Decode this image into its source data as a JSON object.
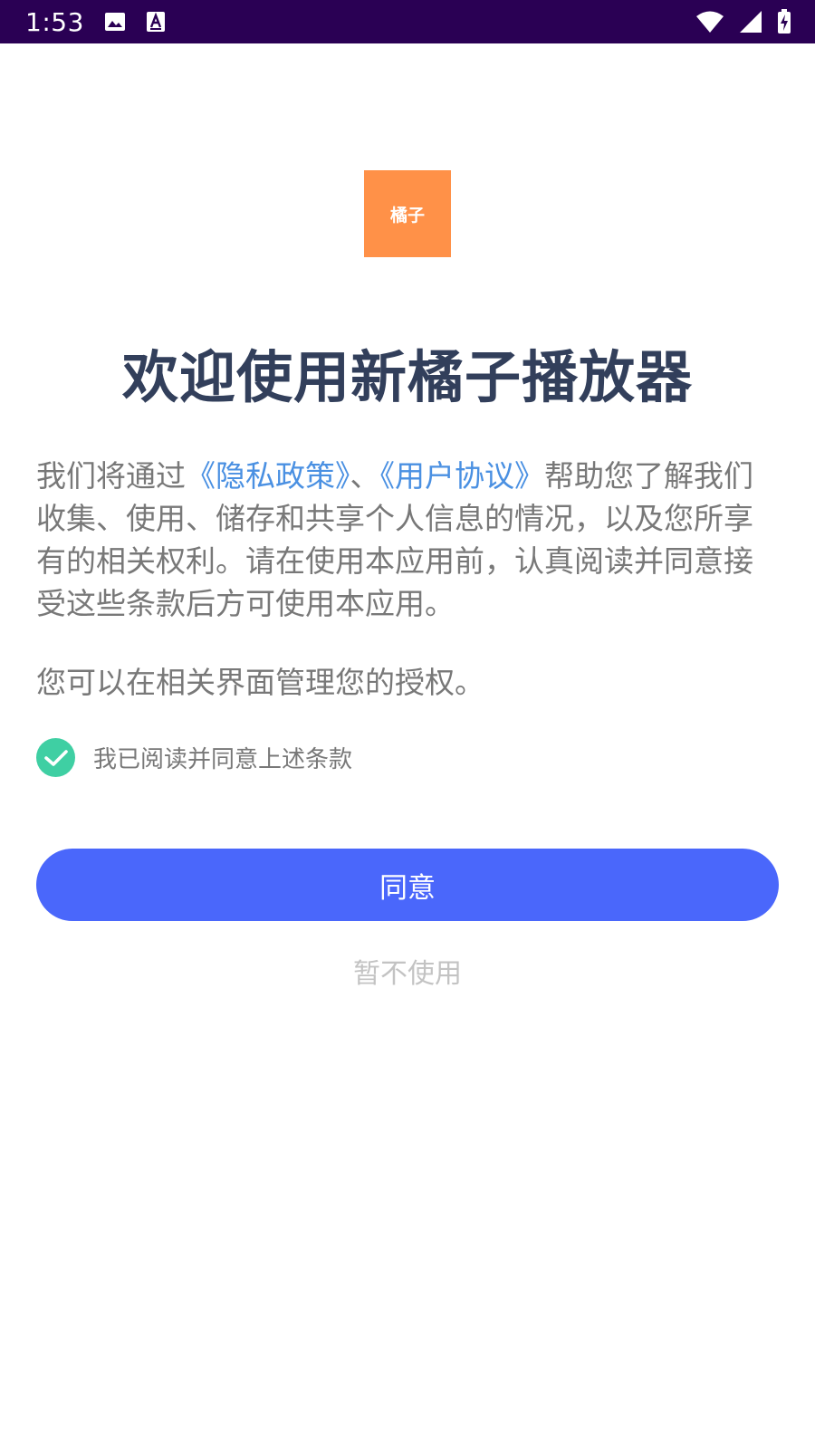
{
  "status_bar": {
    "time": "1:53",
    "notification_icons": [
      "image-icon",
      "text-a-icon"
    ],
    "system_icons": [
      "wifi-icon",
      "cellular-signal-icon",
      "battery-charging-icon"
    ],
    "background_color": "#2a0054"
  },
  "logo": {
    "text": "橘子",
    "color": "#ff9148"
  },
  "title": "欢迎使用新橘子播放器",
  "intro": {
    "text_before": "我们将通过",
    "privacy_link": "《隐私政策》",
    "separator": "、",
    "agreement_link": "《用户协议》",
    "text_after": "帮助您了解我们收集、使用、储存和共享个人信息的情况，以及您所享有的相关权利。请在使用本应用前，认真阅读并同意接受这些条款后方可使用本应用。"
  },
  "auth_note": "您可以在相关界面管理您的授权。",
  "consent": {
    "checked": true,
    "label": "我已阅读并同意上述条款",
    "check_color": "#3fcfa3"
  },
  "buttons": {
    "agree_label": "同意",
    "agree_color": "#4a67fb",
    "decline_label": "暂不使用"
  },
  "colors": {
    "link": "#4a90e2",
    "title": "#323f5b",
    "body_text": "#787878"
  }
}
